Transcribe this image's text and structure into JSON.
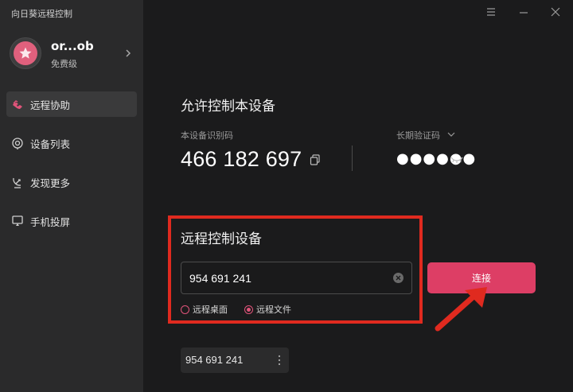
{
  "app": {
    "title": "向日葵远程控制"
  },
  "profile": {
    "username": "or...ob",
    "tier": "免费级"
  },
  "sidebar": {
    "items": [
      {
        "label": "远程协助",
        "icon": "remote-assist-icon",
        "active": true
      },
      {
        "label": "设备列表",
        "icon": "device-list-icon",
        "active": false
      },
      {
        "label": "发现更多",
        "icon": "discover-icon",
        "active": false
      },
      {
        "label": "手机投屏",
        "icon": "screen-cast-icon",
        "active": false
      }
    ]
  },
  "allow": {
    "title": "允许控制本设备",
    "id_label": "本设备识别码",
    "device_id": "466 182 697",
    "code_label": "长期验证码",
    "code_masked": "●●●●●●"
  },
  "remote": {
    "title": "远程控制设备",
    "input_value": "954 691 241",
    "option_desktop": "远程桌面",
    "option_file": "远程文件",
    "selected": "远程文件",
    "connect_label": "连接"
  },
  "recent": {
    "id": "954 691 241"
  },
  "colors": {
    "accent": "#dd3e65",
    "highlight": "#e02a1f",
    "sidebar_bg": "#2a2a2b",
    "main_bg": "#1b1b1c"
  }
}
